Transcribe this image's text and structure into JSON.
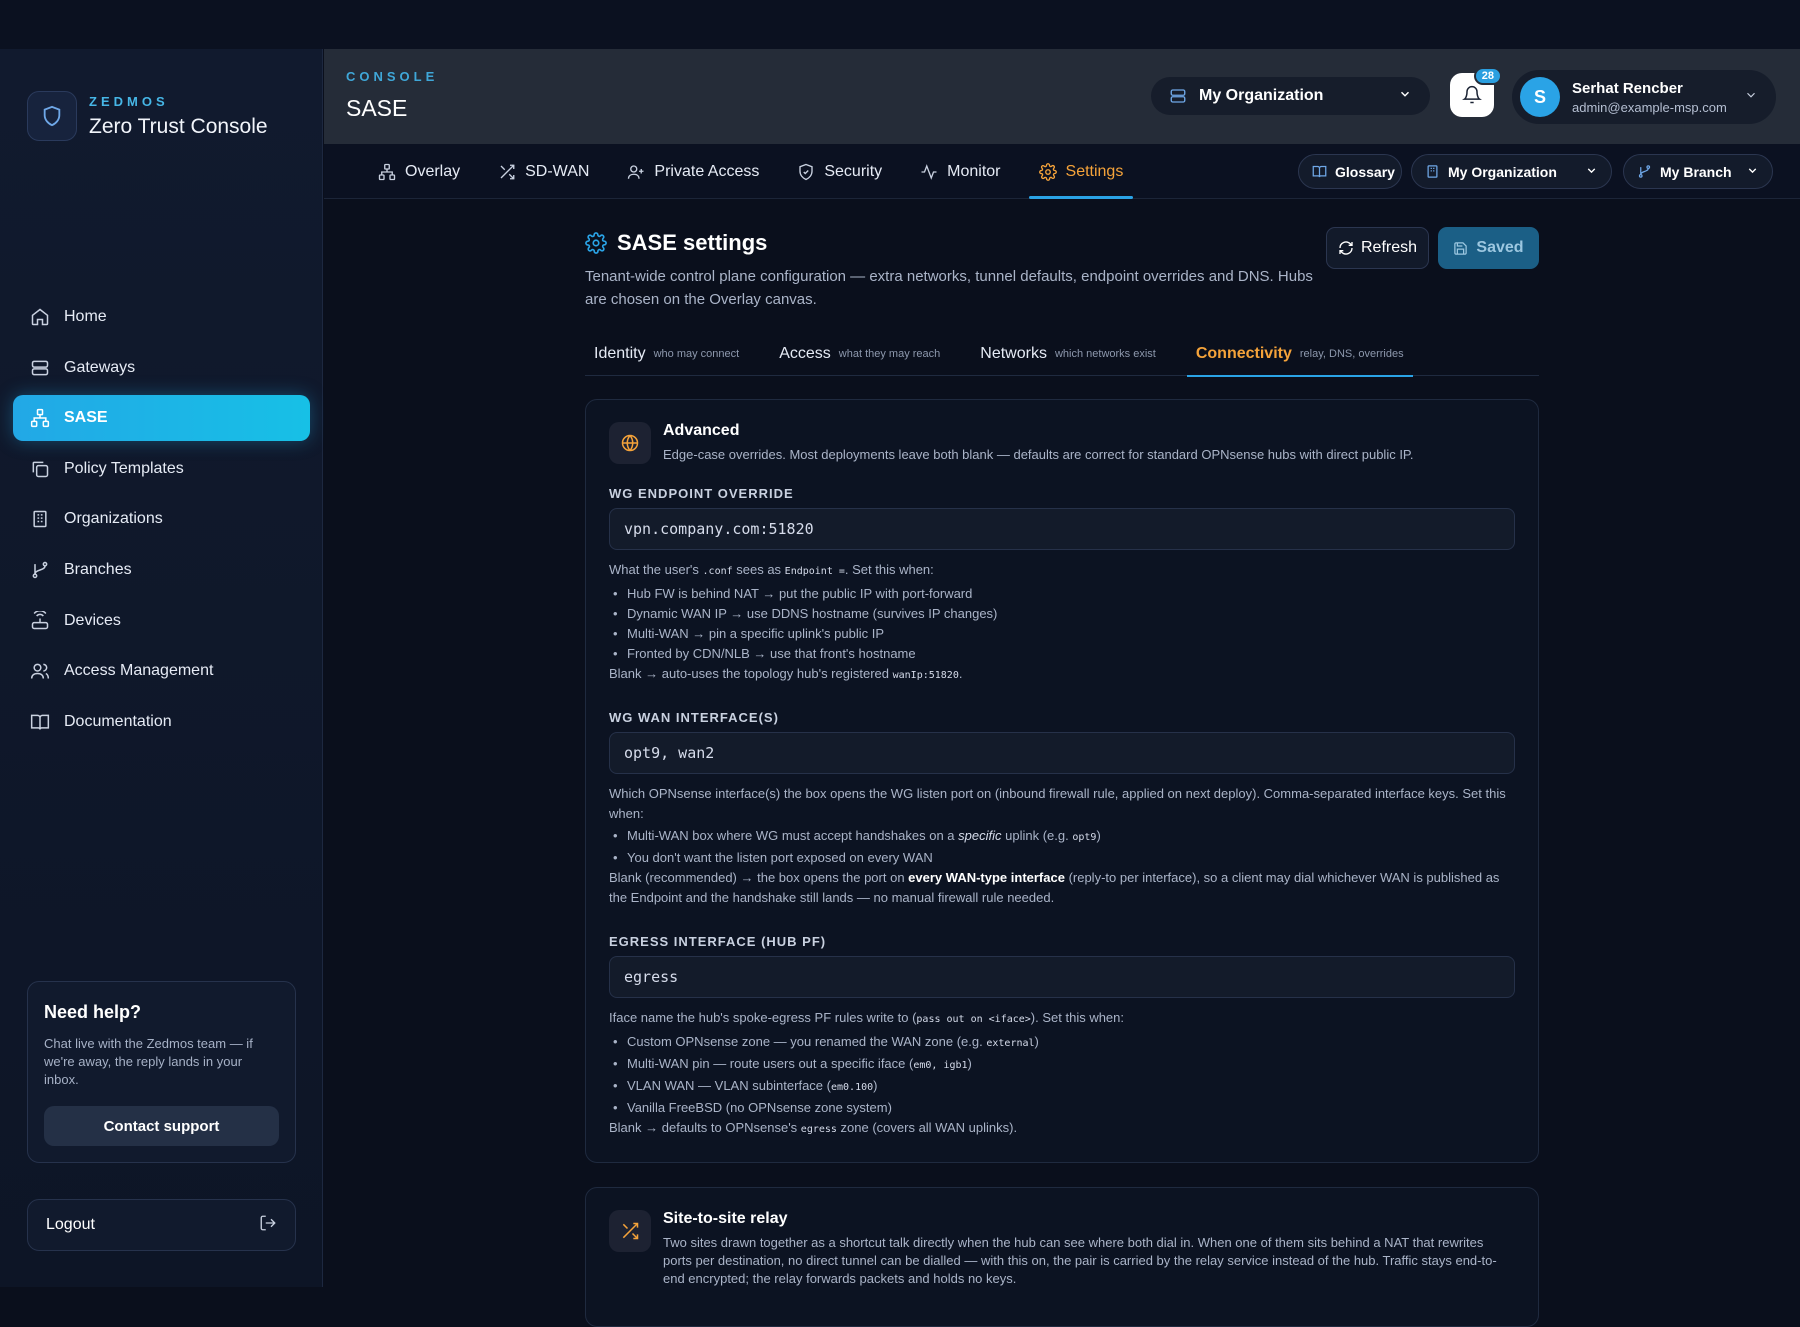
{
  "brand": {
    "eyebrow": "ZEDMOS",
    "title": "Zero Trust Console"
  },
  "sidebar": {
    "items": [
      {
        "label": "Home",
        "icon": "home-icon"
      },
      {
        "label": "Gateways",
        "icon": "server-icon"
      },
      {
        "label": "SASE",
        "icon": "network-icon",
        "active": true
      },
      {
        "label": "Policy Templates",
        "icon": "copy-icon"
      },
      {
        "label": "Organizations",
        "icon": "building-icon"
      },
      {
        "label": "Branches",
        "icon": "branch-icon"
      },
      {
        "label": "Devices",
        "icon": "router-icon"
      },
      {
        "label": "Access Management",
        "icon": "users-icon"
      },
      {
        "label": "Documentation",
        "icon": "book-icon"
      }
    ],
    "help": {
      "title": "Need help?",
      "text": "Chat live with the Zedmos team — if we're away, the reply lands in your inbox.",
      "button": "Contact support"
    },
    "logout": "Logout"
  },
  "header": {
    "eyebrow": "CONSOLE",
    "title": "SASE",
    "org_select": "My Organization",
    "notifications_count": "28",
    "user": {
      "initial": "S",
      "name": "Serhat Rencber",
      "email": "admin@example-msp.com"
    }
  },
  "tabs": [
    {
      "label": "Overlay",
      "icon": "network-icon"
    },
    {
      "label": "SD-WAN",
      "icon": "shuffle-icon"
    },
    {
      "label": "Private Access",
      "icon": "user-plus-icon"
    },
    {
      "label": "Security",
      "icon": "shield-check-icon"
    },
    {
      "label": "Monitor",
      "icon": "activity-icon"
    },
    {
      "label": "Settings",
      "icon": "gear-icon",
      "active": true
    }
  ],
  "toolbar": {
    "glossary": "Glossary",
    "org": "My Organization",
    "branch": "My Branch"
  },
  "settings": {
    "title": "SASE settings",
    "desc": "Tenant-wide control plane configuration — extra networks, tunnel defaults, endpoint overrides and DNS. Hubs are chosen on the Overlay canvas.",
    "refresh": "Refresh",
    "saved": "Saved",
    "subtabs": [
      {
        "label": "Identity",
        "hint": "who may connect"
      },
      {
        "label": "Access",
        "hint": "what they may reach"
      },
      {
        "label": "Networks",
        "hint": "which networks exist"
      },
      {
        "label": "Connectivity",
        "hint": "relay, DNS, overrides",
        "active": true
      }
    ]
  },
  "advanced": {
    "title": "Advanced",
    "desc": "Edge-case overrides. Most deployments leave both blank — defaults are correct for standard OPNsense hubs with direct public IP.",
    "endpoint": {
      "label": "WG ENDPOINT OVERRIDE",
      "value": "vpn.company.com:51820",
      "help_prefix": "What the user's ",
      "help_code1": ".conf",
      "help_mid": " sees as ",
      "help_code2": "Endpoint =",
      "help_suffix": ". Set this when:",
      "bullets": [
        "Hub FW is behind NAT → put the public IP with port-forward",
        "Dynamic WAN IP → use DDNS hostname (survives IP changes)",
        "Multi-WAN → pin a specific uplink's public IP",
        "Fronted by CDN/NLB → use that front's hostname"
      ],
      "blank_prefix": "Blank → auto-uses the topology hub's registered ",
      "blank_code": "wanIp:51820",
      "blank_suffix": "."
    },
    "wan": {
      "label": "WG WAN INTERFACE(S)",
      "value": "opt9, wan2",
      "help": "Which OPNsense interface(s) the box opens the WG listen port on (inbound firewall rule, applied on next deploy). Comma-separated interface keys. Set this when:",
      "b1_prefix": "Multi-WAN box where WG must accept handshakes on a ",
      "b1_em": "specific",
      "b1_mid": " uplink (e.g. ",
      "b1_code": "opt9",
      "b1_suffix": ")",
      "b2": "You don't want the listen port exposed on every WAN",
      "blank_prefix": "Blank (recommended) → the box opens the port on ",
      "blank_bold": "every WAN-type interface",
      "blank_suffix": " (reply-to per interface), so a client may dial whichever WAN is published as the Endpoint and the handshake still lands — no manual firewall rule needed."
    },
    "egress": {
      "label": "EGRESS INTERFACE (HUB PF)",
      "value": "egress",
      "help_prefix": "Iface name the hub's spoke-egress PF rules write to (",
      "help_code": "pass out on <iface>",
      "help_suffix": "). Set this when:",
      "b1_prefix": "Custom OPNsense zone — you renamed the WAN zone (e.g. ",
      "b1_code": "external",
      "b1_suffix": ")",
      "b2_prefix": "Multi-WAN pin — route users out a specific iface (",
      "b2_code": "em0, igb1",
      "b2_suffix": ")",
      "b3_prefix": "VLAN WAN — VLAN subinterface (",
      "b3_code": "em0.100",
      "b3_suffix": ")",
      "b4": "Vanilla FreeBSD (no OPNsense zone system)",
      "blank_prefix": "Blank → defaults to OPNsense's ",
      "blank_code": "egress",
      "blank_suffix": " zone (covers all WAN uplinks)."
    }
  },
  "relay": {
    "title": "Site-to-site relay",
    "desc": "Two sites drawn together as a shortcut talk directly when the hub can see where both dial in. When one of them sits behind a NAT that rewrites ports per destination, no direct tunnel can be dialled — with this on, the pair is carried by the relay service instead of the hub. Traffic stays end-to-end encrypted; the relay forwards packets and holds no keys."
  },
  "colors": {
    "accent": "#2aa3e6",
    "active_tab": "#f5a33a",
    "sidebar_active": "#22a8e6"
  }
}
